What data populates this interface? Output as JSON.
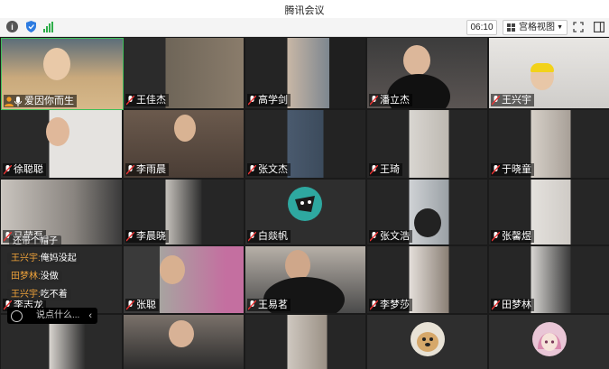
{
  "window": {
    "title": "腾讯会议"
  },
  "toolbar": {
    "info_icon": "info-icon",
    "shield_icon": "shield-icon",
    "signal_icon": "signal-icon",
    "timer": "06:10",
    "view_mode": "宫格视图",
    "fullscreen_icon": "fullscreen-icon",
    "sidebar_icon": "sidebar-toggle-icon"
  },
  "participants": [
    {
      "name": "爱因你而生",
      "host": true
    },
    {
      "name": "王佳杰"
    },
    {
      "name": "高学剑"
    },
    {
      "name": "潘立杰"
    },
    {
      "name": "王兴宇"
    },
    {
      "name": "徐聪聪"
    },
    {
      "name": "李雨晨"
    },
    {
      "name": "张文杰"
    },
    {
      "name": "王琦"
    },
    {
      "name": "于晓童"
    },
    {
      "name": "马萌磊"
    },
    {
      "name": "李晨晓"
    },
    {
      "name": "白燚帆"
    },
    {
      "name": "张文浩"
    },
    {
      "name": "张馨煜"
    },
    {
      "name": "李志龙"
    },
    {
      "name": "张聪"
    },
    {
      "name": "王易茗"
    },
    {
      "name": "李梦莎"
    },
    {
      "name": "田梦林"
    }
  ],
  "chat": {
    "messages": [
      {
        "sender": "",
        "text": "还带个帽子"
      },
      {
        "sender": "王兴宇:",
        "text": "俺妈没起"
      },
      {
        "sender": "田梦林:",
        "text": "没做"
      },
      {
        "sender": "王兴宇:",
        "text": "吃不着"
      }
    ],
    "placeholder": "说点什么..."
  }
}
